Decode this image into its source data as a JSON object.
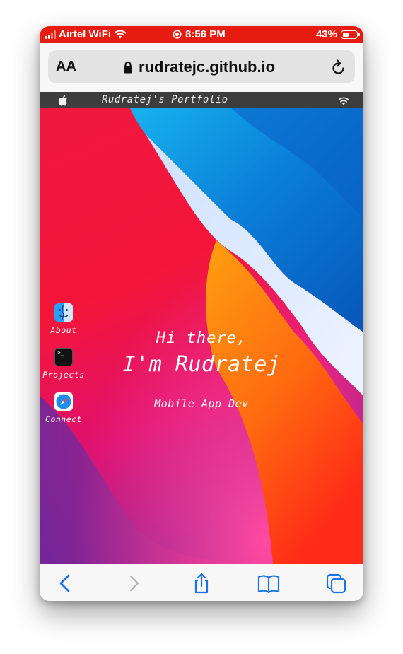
{
  "status_bar": {
    "carrier": "Airtel WiFi",
    "time": "8:56 PM",
    "battery": "43%",
    "battery_level": 0.43,
    "background_color": "#e51c0f"
  },
  "browser": {
    "text_size_label": "AA",
    "domain": "rudratejc.github.io",
    "icons": [
      "lock-icon",
      "reload-icon"
    ]
  },
  "page": {
    "menubar": {
      "title": "Rudratej's Portfolio",
      "icons": [
        "apple-logo-icon",
        "wifi-icon"
      ]
    },
    "desktop_icons": [
      {
        "label": "About",
        "icon": "finder-icon"
      },
      {
        "label": "Projects",
        "icon": "terminal-icon"
      },
      {
        "label": "Connect",
        "icon": "safari-compass-icon"
      }
    ],
    "hero": {
      "greeting": "Hi there,",
      "name": "I'm Rudratej",
      "role": "Mobile App Dev"
    }
  },
  "toolbar": {
    "icons": [
      "back-chevron-icon",
      "forward-chevron-icon",
      "share-icon",
      "bookmarks-icon",
      "tabs-icon"
    ],
    "accent_color": "#1a73e8"
  }
}
